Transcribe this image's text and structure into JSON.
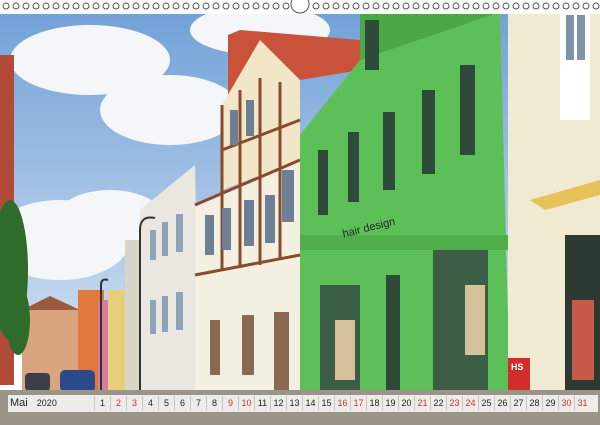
{
  "calendar": {
    "month_label": "Mai",
    "year_label": "2020",
    "days": [
      {
        "n": "1",
        "we": false
      },
      {
        "n": "2",
        "we": true
      },
      {
        "n": "3",
        "we": true
      },
      {
        "n": "4",
        "we": false
      },
      {
        "n": "5",
        "we": false
      },
      {
        "n": "6",
        "we": false
      },
      {
        "n": "7",
        "we": false
      },
      {
        "n": "8",
        "we": false
      },
      {
        "n": "9",
        "we": true
      },
      {
        "n": "10",
        "we": true
      },
      {
        "n": "11",
        "we": false
      },
      {
        "n": "12",
        "we": false
      },
      {
        "n": "13",
        "we": false
      },
      {
        "n": "14",
        "we": false
      },
      {
        "n": "15",
        "we": false
      },
      {
        "n": "16",
        "we": true
      },
      {
        "n": "17",
        "we": true
      },
      {
        "n": "18",
        "we": false
      },
      {
        "n": "19",
        "we": false
      },
      {
        "n": "20",
        "we": false
      },
      {
        "n": "21",
        "we": true
      },
      {
        "n": "22",
        "we": false
      },
      {
        "n": "23",
        "we": true
      },
      {
        "n": "24",
        "we": true
      },
      {
        "n": "25",
        "we": false
      },
      {
        "n": "26",
        "we": false
      },
      {
        "n": "27",
        "we": false
      },
      {
        "n": "28",
        "we": false
      },
      {
        "n": "29",
        "we": false
      },
      {
        "n": "30",
        "we": true
      },
      {
        "n": "31",
        "we": true
      }
    ]
  },
  "signs": {
    "salon": "hair design",
    "shop": "HS"
  },
  "colors": {
    "sky": "#7fa9d8",
    "green_house": "#5dbf58",
    "timber_red": "#c0593a",
    "weekend": "#c0392b"
  }
}
